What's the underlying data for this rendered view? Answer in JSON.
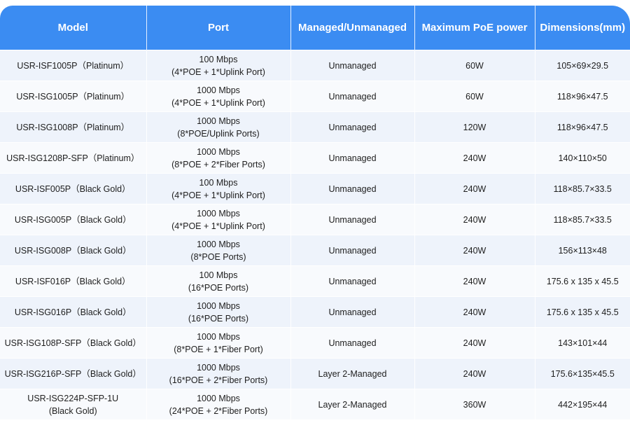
{
  "colors": {
    "header_bg": "#3b8cf2",
    "row_odd": "#eef3fb",
    "row_even": "#f8fafd"
  },
  "headers": [
    "Model",
    "Port",
    "Managed/Unmanaged",
    "Maximum PoE power",
    "Dimensions(mm)"
  ],
  "rows": [
    {
      "model": [
        "USR-ISF1005P（Platinum）"
      ],
      "port": [
        "100 Mbps",
        "(4*POE + 1*Uplink Port)"
      ],
      "managed": "Unmanaged",
      "power": "60W",
      "dimensions": "105×69×29.5"
    },
    {
      "model": [
        "USR-ISG1005P（Platinum）"
      ],
      "port": [
        "1000 Mbps",
        "(4*POE + 1*Uplink Port)"
      ],
      "managed": "Unmanaged",
      "power": "60W",
      "dimensions": "118×96×47.5"
    },
    {
      "model": [
        "USR-ISG1008P（Platinum）"
      ],
      "port": [
        "1000 Mbps",
        "(8*POE/Uplink Ports)"
      ],
      "managed": "Unmanaged",
      "power": "120W",
      "dimensions": "118×96×47.5"
    },
    {
      "model": [
        "USR-ISG1208P-SFP（Platinum）"
      ],
      "port": [
        "1000 Mbps",
        "(8*POE + 2*Fiber Ports)"
      ],
      "managed": "Unmanaged",
      "power": "240W",
      "dimensions": "140×110×50"
    },
    {
      "model": [
        "USR-ISF005P（Black Gold）"
      ],
      "port": [
        "100 Mbps",
        "(4*POE + 1*Uplink Port)"
      ],
      "managed": "Unmanaged",
      "power": "240W",
      "dimensions": "118×85.7×33.5"
    },
    {
      "model": [
        "USR-ISG005P（Black Gold）"
      ],
      "port": [
        "1000 Mbps",
        "(4*POE + 1*Uplink Port)"
      ],
      "managed": "Unmanaged",
      "power": "240W",
      "dimensions": "118×85.7×33.5"
    },
    {
      "model": [
        "USR-ISG008P（Black Gold）"
      ],
      "port": [
        "1000 Mbps",
        "(8*POE Ports)"
      ],
      "managed": "Unmanaged",
      "power": "240W",
      "dimensions": "156×113×48"
    },
    {
      "model": [
        "USR-ISF016P（Black Gold）"
      ],
      "port": [
        "100 Mbps",
        "(16*POE Ports)"
      ],
      "managed": "Unmanaged",
      "power": "240W",
      "dimensions": "175.6 x 135 x 45.5"
    },
    {
      "model": [
        "USR-ISG016P（Black Gold）"
      ],
      "port": [
        "1000 Mbps",
        "(16*POE Ports)"
      ],
      "managed": "Unmanaged",
      "power": "240W",
      "dimensions": "175.6 x 135 x 45.5"
    },
    {
      "model": [
        "USR-ISG108P-SFP（Black Gold）"
      ],
      "port": [
        "1000 Mbps",
        "(8*POE + 1*Fiber Port)"
      ],
      "managed": "Unmanaged",
      "power": "240W",
      "dimensions": "143×101×44"
    },
    {
      "model": [
        "USR-ISG216P-SFP（Black Gold）"
      ],
      "port": [
        "1000 Mbps",
        "(16*POE + 2*Fiber Ports)"
      ],
      "managed": "Layer 2-Managed",
      "power": "240W",
      "dimensions": "175.6×135×45.5"
    },
    {
      "model": [
        "USR-ISG224P-SFP-1U",
        "(Black Gold)"
      ],
      "port": [
        "1000 Mbps",
        "(24*POE + 2*Fiber Ports)"
      ],
      "managed": "Layer 2-Managed",
      "power": "360W",
      "dimensions": "442×195×44"
    }
  ]
}
